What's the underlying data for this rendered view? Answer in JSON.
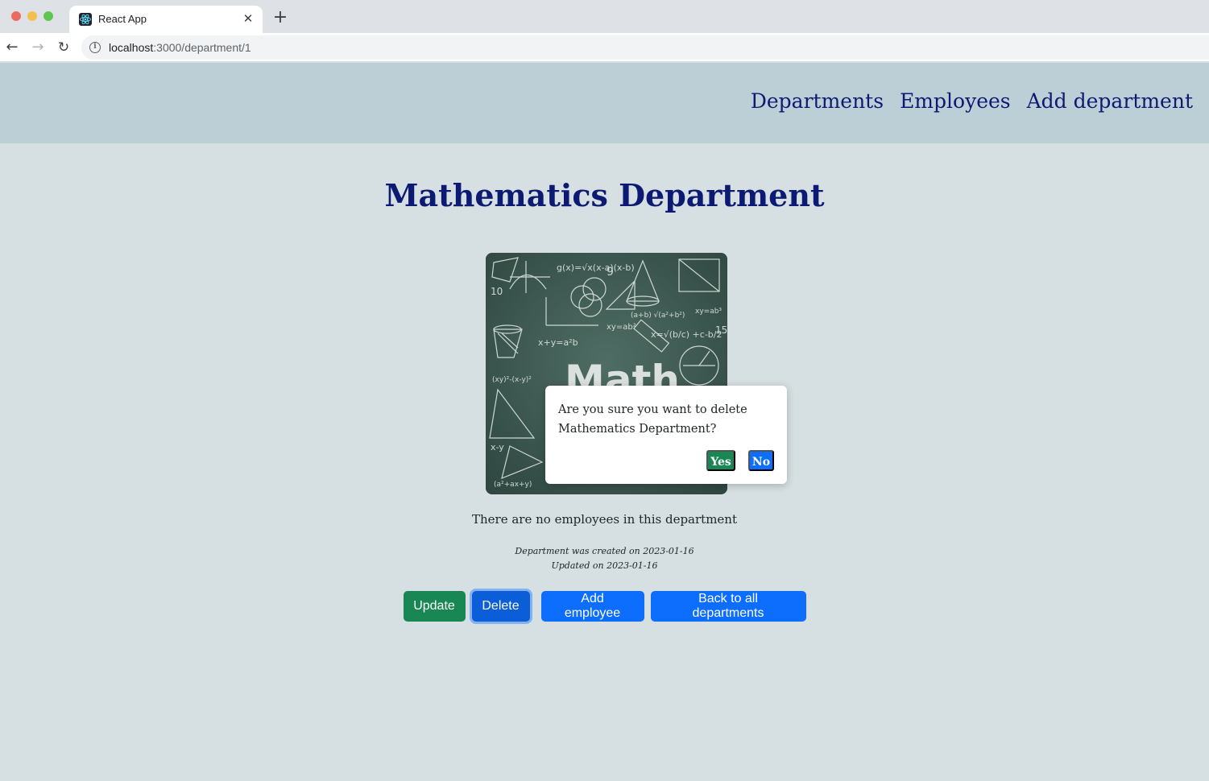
{
  "browser": {
    "tab_title": "React App",
    "tab_close_icon": "close-icon",
    "new_tab_icon": "plus-icon",
    "url_host": "localhost",
    "url_rest": ":3000/department/1",
    "back_icon": "arrow-left-icon",
    "forward_icon": "arrow-right-icon",
    "reload_icon": "reload-icon",
    "info_icon": "info-icon"
  },
  "header": {
    "nav": [
      {
        "label": "Departments"
      },
      {
        "label": "Employees"
      },
      {
        "label": "Add department"
      }
    ]
  },
  "department": {
    "title": "Mathematics Department",
    "image_alt": "Math",
    "employees_text": "There are no employees in this department",
    "created_text": "Department was created on 2023-01-16",
    "updated_text": "Updated on 2023-01-16"
  },
  "actions": {
    "update_label": "Update",
    "delete_label": "Delete",
    "add_employee_label": "Add employee",
    "back_label": "Back to all departments"
  },
  "confirm": {
    "message": "Are you sure you want to delete Mathematics Department?",
    "yes_label": "Yes",
    "no_label": "No"
  },
  "colors": {
    "header_bg": "#bdcfd6",
    "page_bg": "#d6dfe1",
    "link_color": "#0c1a73",
    "success": "#198754",
    "primary": "#0d6efd"
  }
}
